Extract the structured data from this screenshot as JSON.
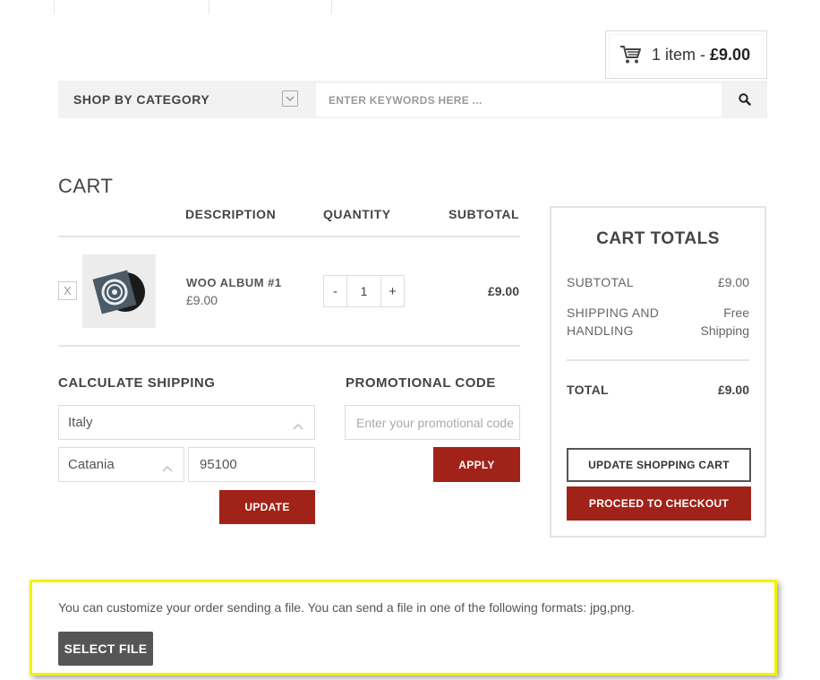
{
  "cart_widget": {
    "count": "1 item",
    "separator": "-",
    "amount": "£9.00"
  },
  "search": {
    "category_label": "SHOP BY CATEGORY",
    "placeholder": "ENTER KEYWORDS HERE ..."
  },
  "cart": {
    "title": "CART",
    "headers": {
      "description": "DESCRIPTION",
      "quantity": "QUANTITY",
      "subtotal": "SUBTOTAL"
    },
    "items": [
      {
        "remove": "X",
        "name": "WOO ALBUM #1",
        "price": "£9.00",
        "qty_minus": "-",
        "quantity": "1",
        "qty_plus": "+",
        "subtotal": "£9.00"
      }
    ]
  },
  "shipping": {
    "title": "CALCULATE SHIPPING",
    "country": "Italy",
    "city": "Catania",
    "postcode": "95100",
    "update_label": "UPDATE"
  },
  "promo": {
    "title": "PROMOTIONAL CODE",
    "placeholder": "Enter your promotional code",
    "apply_label": "APPLY"
  },
  "totals": {
    "title": "CART TOTALS",
    "subtotal_label": "SUBTOTAL",
    "subtotal_value": "£9.00",
    "shipping_label_1": "SHIPPING AND",
    "shipping_label_2": "HANDLING",
    "shipping_value_1": "Free",
    "shipping_value_2": "Shipping",
    "total_label": "TOTAL",
    "total_value": "£9.00",
    "update_cart_label": "UPDATE SHOPPING CART",
    "checkout_label": "PROCEED TO CHECKOUT"
  },
  "upload": {
    "message": "You can customize your order sending a file. You can send a file in one of the following formats: jpg,png.",
    "button_label": "SELECT FILE"
  },
  "colors": {
    "accent": "#a12218",
    "highlight": "#f2f200",
    "dark_button": "#565656"
  }
}
